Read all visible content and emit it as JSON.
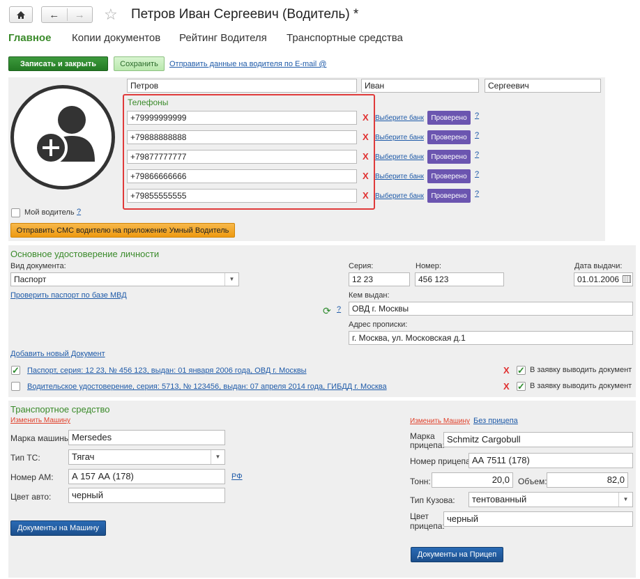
{
  "window": {
    "title": "Петров Иван Сергеевич (Водитель) *"
  },
  "tabs": [
    "Главное",
    "Копии документов",
    "Рейтинг Водителя",
    "Транспортные средства"
  ],
  "toolbar": {
    "save_close": "Записать и закрыть",
    "save": "Сохранить",
    "email_link": "Отправить данные на водителя по E-mail @"
  },
  "driver": {
    "last_name": "Петров",
    "first_name": "Иван",
    "middle_name": "Сергеевич",
    "phones_title": "Телефоны",
    "phones": [
      "+79999999999",
      "+79888888888",
      "+79877777777",
      "+79866666666",
      "+79855555555"
    ],
    "select_bank": "Выберите банк",
    "verified": "Проверено",
    "question": "?",
    "remove": "X",
    "my_driver": "Мой водитель",
    "sms_button": "Отправить СМС водителю на приложение Умный Водитель",
    "colors": {
      "accent_green": "#3a8a2a",
      "verified_purple": "#6b55b0",
      "frame_red": "#e03a3a",
      "sms_orange": "#f2a01a"
    }
  },
  "identity": {
    "title": "Основное удостоверение личности",
    "doc_type_label": "Вид документа:",
    "doc_type": "Паспорт",
    "check_link": "Проверить паспорт по базе МВД",
    "series_label": "Серия:",
    "series": "12 23",
    "number_label": "Номер:",
    "number": "456 123",
    "issue_date_label": "Дата выдачи:",
    "issue_date": "01.01.2006",
    "issued_by_label": "Кем выдан:",
    "issued_by": "ОВД г. Москвы",
    "address_label": "Адрес прописки:",
    "address": "г. Москва, ул. Московская д.1",
    "add_doc_link": "Добавить новый Документ",
    "docs": [
      {
        "text": "Паспорт, серия: 12 23, № 456 123, выдан: 01 января 2006 года, ОВД г. Москвы",
        "checked": true,
        "output_label": "В заявку выводить документ"
      },
      {
        "text": "Водительское удостоверение, серия: 5713, № 123456, выдан: 07 апреля 2014 года, ГИБДД г. Москва",
        "checked": false,
        "output_label": "В заявку выводить документ"
      }
    ]
  },
  "vehicle": {
    "title": "Транспортное средство",
    "change_car": "Изменить Машину",
    "brand_label": "Марка машины:",
    "brand": "Mersedes",
    "type_label": "Тип ТС:",
    "type": "Тягач",
    "plate_label": "Номер АМ:",
    "plate": "А 157 АА (178)",
    "plate_region_link": "РФ",
    "color_label": "Цвет авто:",
    "color": "черный",
    "docs_button": "Документы на Машину"
  },
  "trailer": {
    "change_car": "Изменить Машину",
    "no_trailer": "Без прицепа",
    "brand_label_1": "Марка",
    "brand_label_2": "прицепа:",
    "brand": "Schmitz Cargobull",
    "plate_label": "Номер прицепа:",
    "plate": "АА 7511 (178)",
    "tons_label": "Тонн:",
    "tons": "20,0",
    "volume_label": "Объем:",
    "volume": "82,0",
    "body_label": "Тип Кузова:",
    "body": "тентованный",
    "color_label_1": "Цвет",
    "color_label_2": "прицепа:",
    "color": "черный",
    "docs_button": "Документы на Прицеп"
  }
}
